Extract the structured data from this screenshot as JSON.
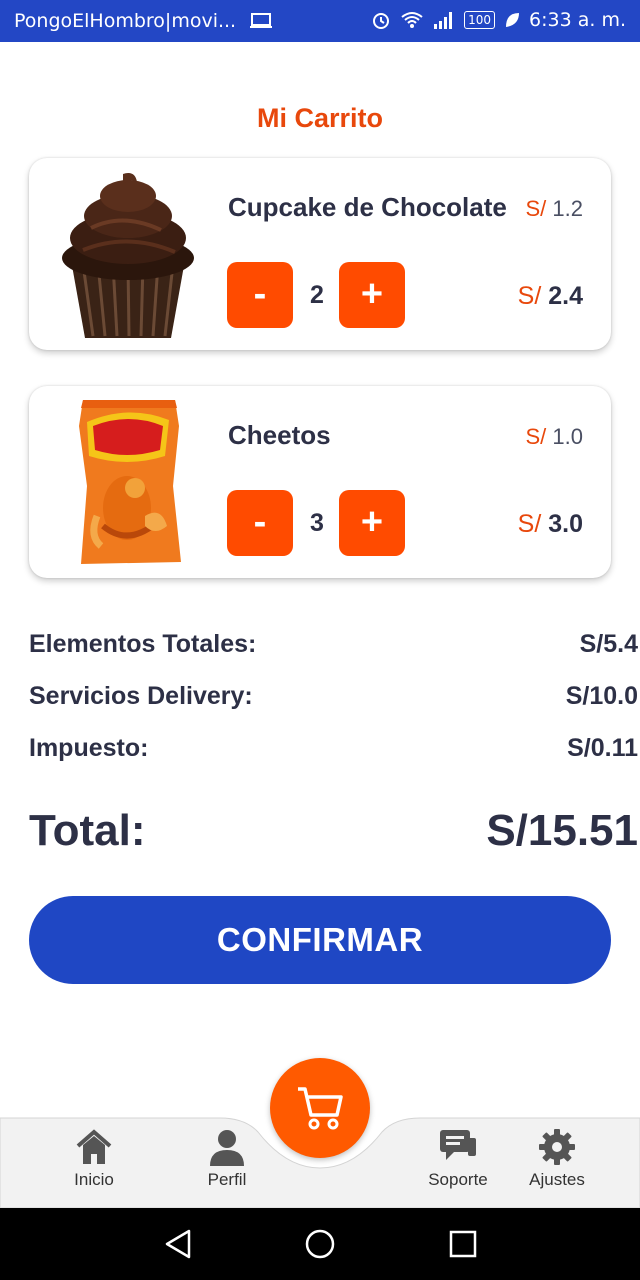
{
  "status_bar": {
    "carrier": "PongoElHombro|movi...",
    "battery": "100",
    "time": "6:33 a. m."
  },
  "page_title": "Mi Carrito",
  "currency": "S/",
  "cart_items": [
    {
      "name": "Cupcake de Chocolate",
      "unit_price": "1.2",
      "quantity": "2",
      "subtotal": "2.4",
      "minus_label": "-",
      "plus_label": "+"
    },
    {
      "name": "Cheetos",
      "unit_price": "1.0",
      "quantity": "3",
      "subtotal": "3.0",
      "minus_label": "-",
      "plus_label": "+"
    }
  ],
  "summary": {
    "items_label": "Elementos Totales:",
    "items_value": "S/5.4",
    "delivery_label": "Servicios Delivery:",
    "delivery_value": "S/10.0",
    "tax_label": "Impuesto:",
    "tax_value": "S/0.11",
    "total_label": "Total:",
    "total_value": "S/15.51"
  },
  "confirm_label": "CONFIRMAR",
  "bottom_nav": {
    "items": [
      {
        "label": "Inicio",
        "icon": "home-icon"
      },
      {
        "label": "Perfil",
        "icon": "user-icon"
      },
      {
        "label": "Soporte",
        "icon": "chat-icon"
      },
      {
        "label": "Ajustes",
        "icon": "gear-icon"
      }
    ],
    "fab_icon": "cart-icon"
  },
  "colors": {
    "accent": "#ff4b00",
    "primary": "#1f47c4",
    "title": "#e8480c",
    "text": "#2d3046"
  }
}
